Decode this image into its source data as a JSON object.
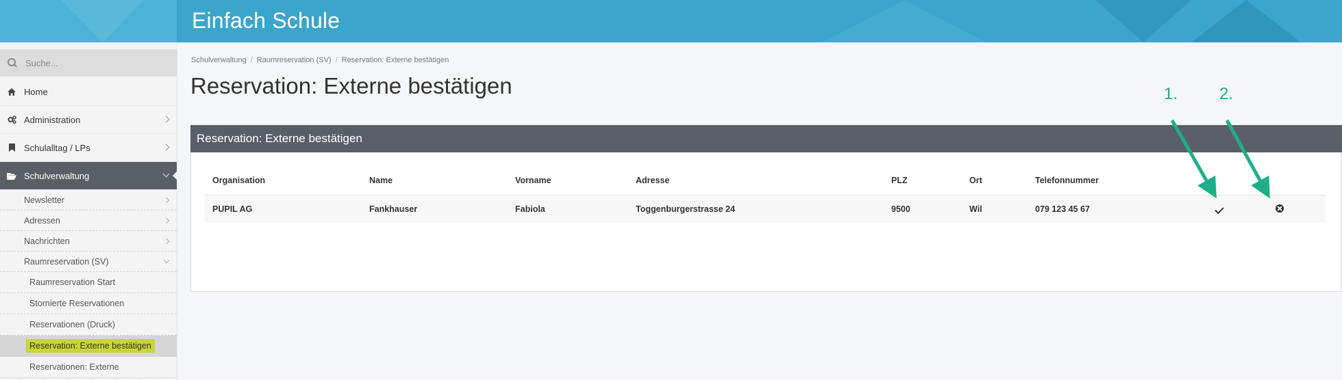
{
  "header": {
    "brand": "Einfach Schule"
  },
  "sidebar": {
    "search_placeholder": "Suche...",
    "items": [
      {
        "label": "Home",
        "icon": "home-icon"
      },
      {
        "label": "Administration",
        "icon": "cogs-icon"
      },
      {
        "label": "Schulalltag / LPs",
        "icon": "bookmark-icon"
      },
      {
        "label": "Schulverwaltung",
        "icon": "folder-open-icon"
      }
    ],
    "sub": [
      {
        "label": "Newsletter"
      },
      {
        "label": "Adressen"
      },
      {
        "label": "Nachrichten"
      },
      {
        "label": "Raumreservation (SV)"
      }
    ],
    "subsub": [
      {
        "label": "Raumreservation Start"
      },
      {
        "label": "Stornierte Reservationen"
      },
      {
        "label": "Reservationen (Druck)"
      },
      {
        "label": "Reservation: Externe bestätigen"
      },
      {
        "label": "Reservationen: Externe"
      }
    ]
  },
  "breadcrumb": [
    "Schulverwaltung",
    "Raumreservation (SV)",
    "Reservation: Externe bestätigen"
  ],
  "page_title": "Reservation: Externe bestätigen",
  "annotations": [
    "1.",
    "2."
  ],
  "annotation_color": "#1fae8c",
  "panel": {
    "title": "Reservation: Externe bestätigen",
    "columns": [
      "Organisation",
      "Name",
      "Vorname",
      "Adresse",
      "PLZ",
      "Ort",
      "Telefonnummer"
    ],
    "rows": [
      {
        "organisation": "PUPIL AG",
        "name": "Fankhauser",
        "vorname": "Fabiola",
        "adresse": "Toggenburgerstrasse 24",
        "plz": "9500",
        "ort": "Wil",
        "telefon": "079 123 45 67"
      }
    ]
  }
}
